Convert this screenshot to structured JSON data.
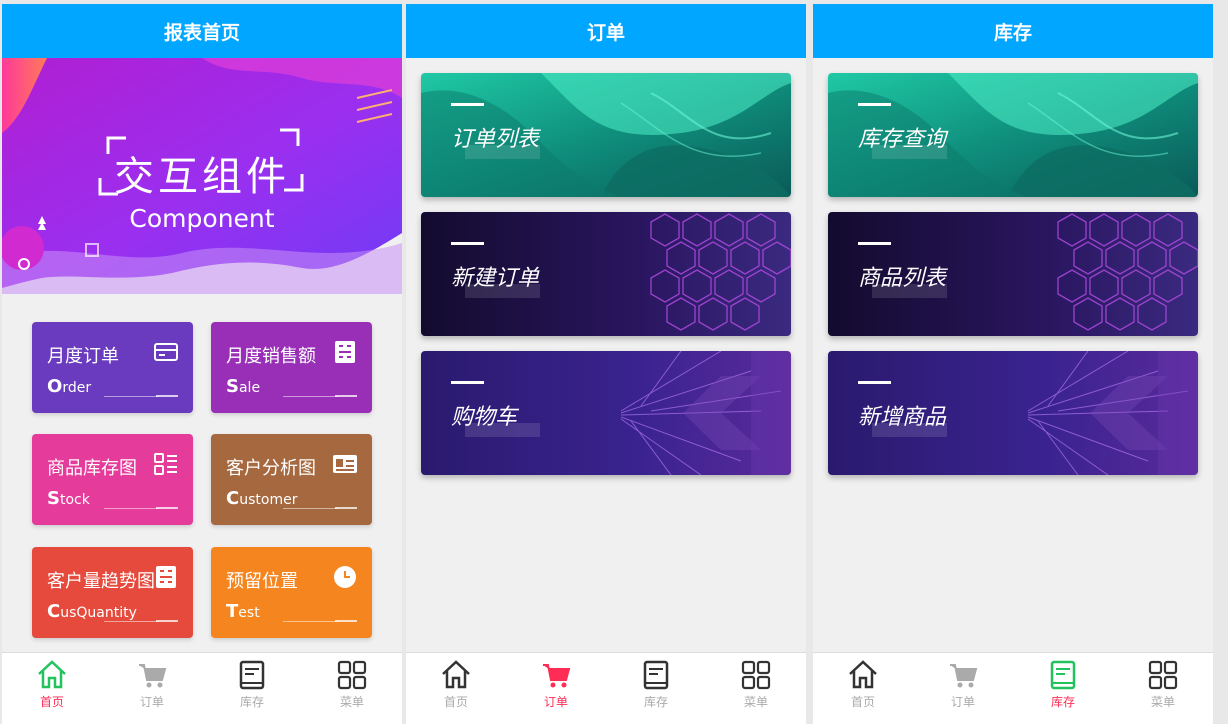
{
  "screens": {
    "home": {
      "title": "报表首页",
      "banner": {
        "title": "交互组件",
        "subtitle": "Component"
      },
      "cards": [
        {
          "title": "月度订单",
          "sub_initial": "O",
          "sub_rest": "rder",
          "color": "#6a3bbf",
          "icon": "card-icon"
        },
        {
          "title": "月度销售额",
          "sub_initial": "S",
          "sub_rest": "ale",
          "color": "#9a2fb7",
          "icon": "calculator-icon"
        },
        {
          "title": "商品库存图",
          "sub_initial": "S",
          "sub_rest": "tock",
          "color": "#e53b9a",
          "icon": "list-grid-icon"
        },
        {
          "title": "客户分析图",
          "sub_initial": "C",
          "sub_rest": "ustomer",
          "color": "#a5683f",
          "icon": "id-card-icon"
        },
        {
          "title": "客户量趋势图",
          "sub_initial": "C",
          "sub_rest": "usQuantity",
          "color": "#e54a3c",
          "icon": "calculator-icon"
        },
        {
          "title": "预留位置",
          "sub_initial": "T",
          "sub_rest": "est",
          "color": "#f5851f",
          "icon": "clock-icon"
        }
      ]
    },
    "orders": {
      "title": "订单",
      "items": [
        {
          "label": "订单列表"
        },
        {
          "label": "新建订单"
        },
        {
          "label": "购物车"
        }
      ]
    },
    "stock": {
      "title": "库存",
      "items": [
        {
          "label": "库存查询"
        },
        {
          "label": "商品列表"
        },
        {
          "label": "新增商品"
        }
      ]
    }
  },
  "tabbar": {
    "labels": {
      "home": "首页",
      "orders": "订单",
      "stock": "库存",
      "menu": "菜单"
    }
  },
  "colors": {
    "accent": "#00a6ff",
    "active_label": "#ff2d55",
    "active_home_icon": "#22c35e",
    "active_cart_icon": "#ff2d55",
    "inactive": "#aaaaaa"
  }
}
